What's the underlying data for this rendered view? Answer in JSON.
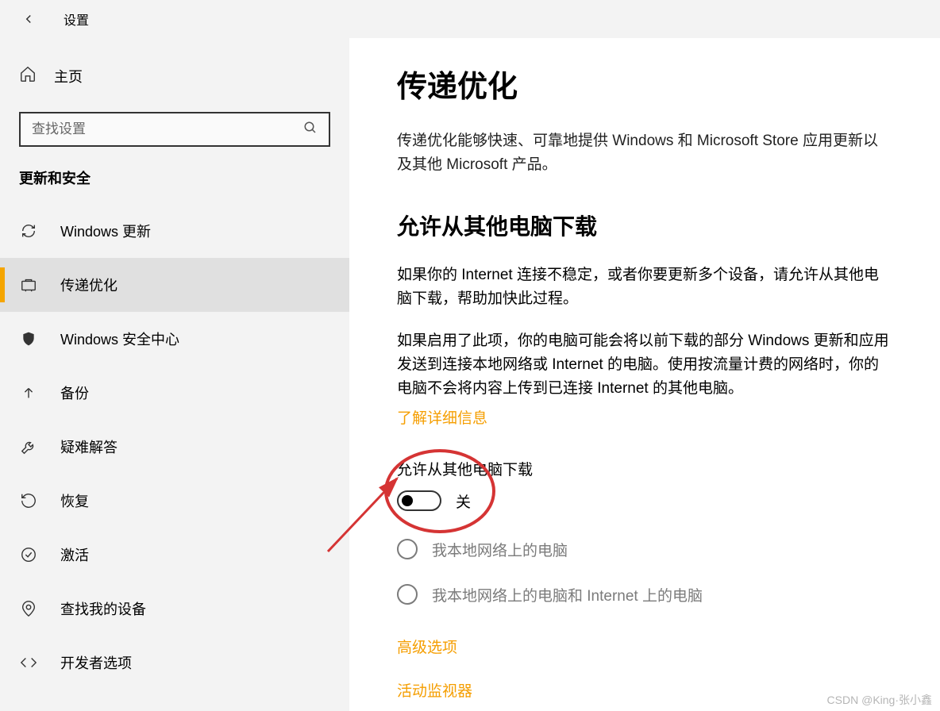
{
  "header": {
    "title": "设置"
  },
  "sidebar": {
    "home": "主页",
    "search_placeholder": "查找设置",
    "group": "更新和安全",
    "items": [
      {
        "label": "Windows 更新",
        "icon": "sync"
      },
      {
        "label": "传递优化",
        "icon": "delivery",
        "active": true
      },
      {
        "label": "Windows 安全中心",
        "icon": "shield"
      },
      {
        "label": "备份",
        "icon": "backup"
      },
      {
        "label": "疑难解答",
        "icon": "troubleshoot"
      },
      {
        "label": "恢复",
        "icon": "recovery"
      },
      {
        "label": "激活",
        "icon": "activation"
      },
      {
        "label": "查找我的设备",
        "icon": "find"
      },
      {
        "label": "开发者选项",
        "icon": "developer"
      }
    ]
  },
  "main": {
    "title": "传递优化",
    "desc": "传递优化能够快速、可靠地提供 Windows 和 Microsoft Store 应用更新以及其他 Microsoft 产品。",
    "section_title": "允许从其他电脑下载",
    "para1": "如果你的 Internet 连接不稳定，或者你要更新多个设备，请允许从其他电脑下载，帮助加快此过程。",
    "para2": "如果启用了此项，你的电脑可能会将以前下载的部分 Windows 更新和应用发送到连接本地网络或 Internet 的电脑。使用按流量计费的网络时，你的电脑不会将内容上传到已连接 Internet 的其他电脑。",
    "learn_more": "了解详细信息",
    "toggle_label": "允许从其他电脑下载",
    "toggle_state": "关",
    "radio1": "我本地网络上的电脑",
    "radio2": "我本地网络上的电脑和 Internet 上的电脑",
    "advanced": "高级选项",
    "monitor": "活动监视器"
  },
  "watermark": "CSDN @King·张小鑫"
}
